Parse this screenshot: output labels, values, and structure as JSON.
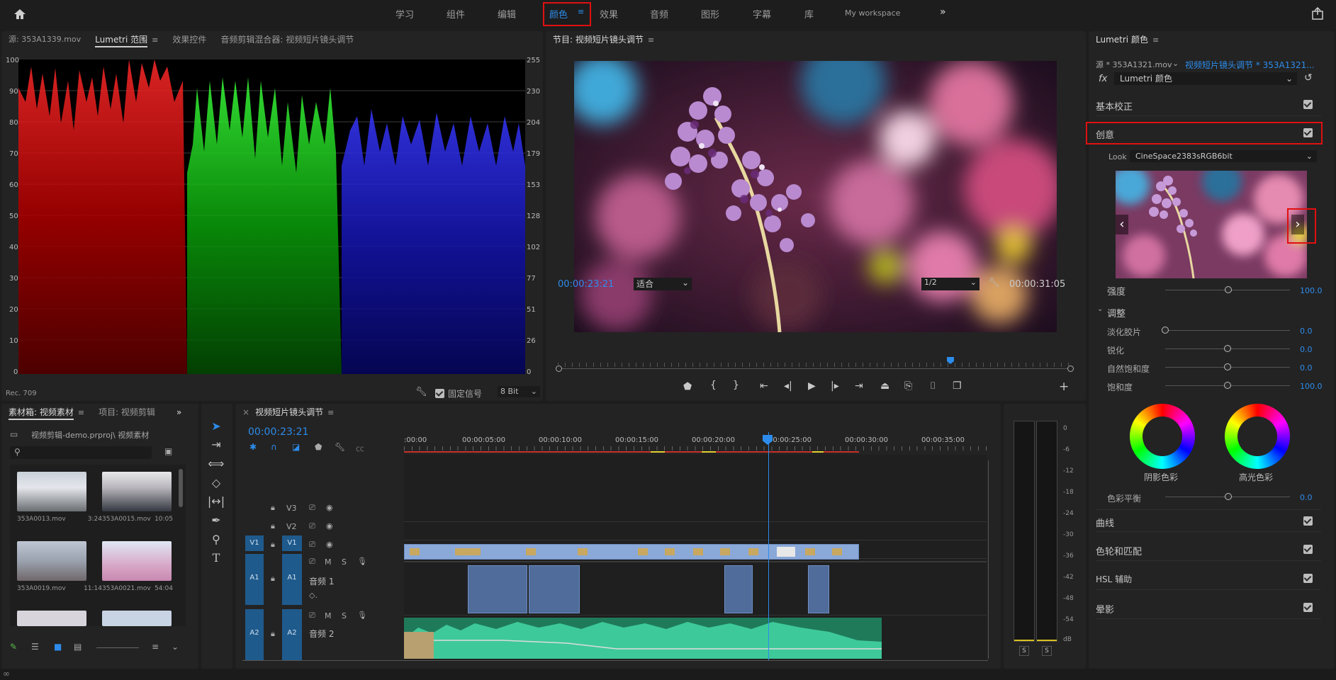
{
  "workspaces": {
    "items": [
      "学习",
      "组件",
      "编辑",
      "颜色",
      "效果",
      "音频",
      "图形",
      "字幕",
      "库",
      "My workspace"
    ],
    "active": "颜色"
  },
  "scope_panel": {
    "tabs": [
      "源: 353A1339.mov",
      "Lumetri 范围",
      "效果控件",
      "音频剪辑混合器: 视频短片镜头调节"
    ],
    "left_ticks": [
      "100",
      "90",
      "80",
      "70",
      "60",
      "50",
      "40",
      "30",
      "20",
      "10",
      "0"
    ],
    "right_ticks": [
      "255",
      "230",
      "204",
      "179",
      "153",
      "128",
      "102",
      "77",
      "51",
      "26",
      "0"
    ],
    "footer_left": "Rec. 709",
    "clamp_label": "固定信号",
    "bit_depth": "8 Bit"
  },
  "program": {
    "title": "节目: 视频短片镜头调节",
    "timecode": "00:00:23:21",
    "fit": "适合",
    "resolution": "1/2",
    "duration": "00:00:31:05"
  },
  "lumetri": {
    "title": "Lumetri 颜色",
    "source": "源 * 353A1321.mov",
    "sequence": "视频短片镜头调节 * 353A1321...",
    "fx_label": "fx",
    "effect": "Lumetri 颜色",
    "sections": [
      "基本校正",
      "创意"
    ],
    "look_label": "Look",
    "look_value": "CineSpace2383sRGB6bit",
    "intensity_label": "强度",
    "intensity_value": "100.0",
    "adjust_label": "调整",
    "sliders": [
      {
        "label": "淡化胶片",
        "value": "0.0",
        "level": 0
      },
      {
        "label": "锐化",
        "value": "0.0",
        "level": 0.5
      },
      {
        "label": "自然饱和度",
        "value": "0.0",
        "level": 0.5
      },
      {
        "label": "饱和度",
        "value": "100.0",
        "level": 0.5
      }
    ],
    "wheel_shadow": "阴影色彩",
    "wheel_highlight": "高光色彩",
    "balance_label": "色彩平衡",
    "balance_value": "0.0",
    "bottom_sections": [
      "曲线",
      "色轮和匹配",
      "HSL 辅助",
      "晕影"
    ]
  },
  "bin": {
    "tabs": [
      "素材箱: 视频素材",
      "项目: 视频剪辑"
    ],
    "path": "视频剪辑-demo.prproj\\ 视频素材",
    "items": [
      {
        "name": "353A0013.mov",
        "dur": "3:24"
      },
      {
        "name": "353A0015.mov",
        "dur": "10:05"
      },
      {
        "name": "353A0019.mov",
        "dur": "11:14"
      },
      {
        "name": "353A0021.mov",
        "dur": "54:04"
      }
    ]
  },
  "timeline": {
    "title": "视频短片镜头调节",
    "timecode": "00:00:23:21",
    "ruler": [
      ":00:00",
      "00:00:05:00",
      "00:00:10:00",
      "00:00:15:00",
      "00:00:20:00",
      "00:00:25:00",
      "00:00:30:00",
      "00:00:35:00"
    ],
    "tracks_v": [
      "V3",
      "V2",
      "V1"
    ],
    "tracks_a": [
      "A1",
      "A2"
    ],
    "audio_names": [
      "音频 1",
      "音频 2"
    ],
    "source_patch_v": "V1",
    "source_patch_a1": "A1",
    "source_patch_a2": "A2"
  },
  "meter": {
    "ticks": [
      "0",
      "-6",
      "-12",
      "-18",
      "-24",
      "-30",
      "-36",
      "-42",
      "-48",
      "-54",
      "dB"
    ],
    "solo": [
      "S",
      "S"
    ]
  },
  "colors": {
    "accent": "#2d8ceb",
    "red_highlight": "#e01010",
    "video_clip": "#8aa8d8",
    "audio_clip": "#3ec99a"
  }
}
